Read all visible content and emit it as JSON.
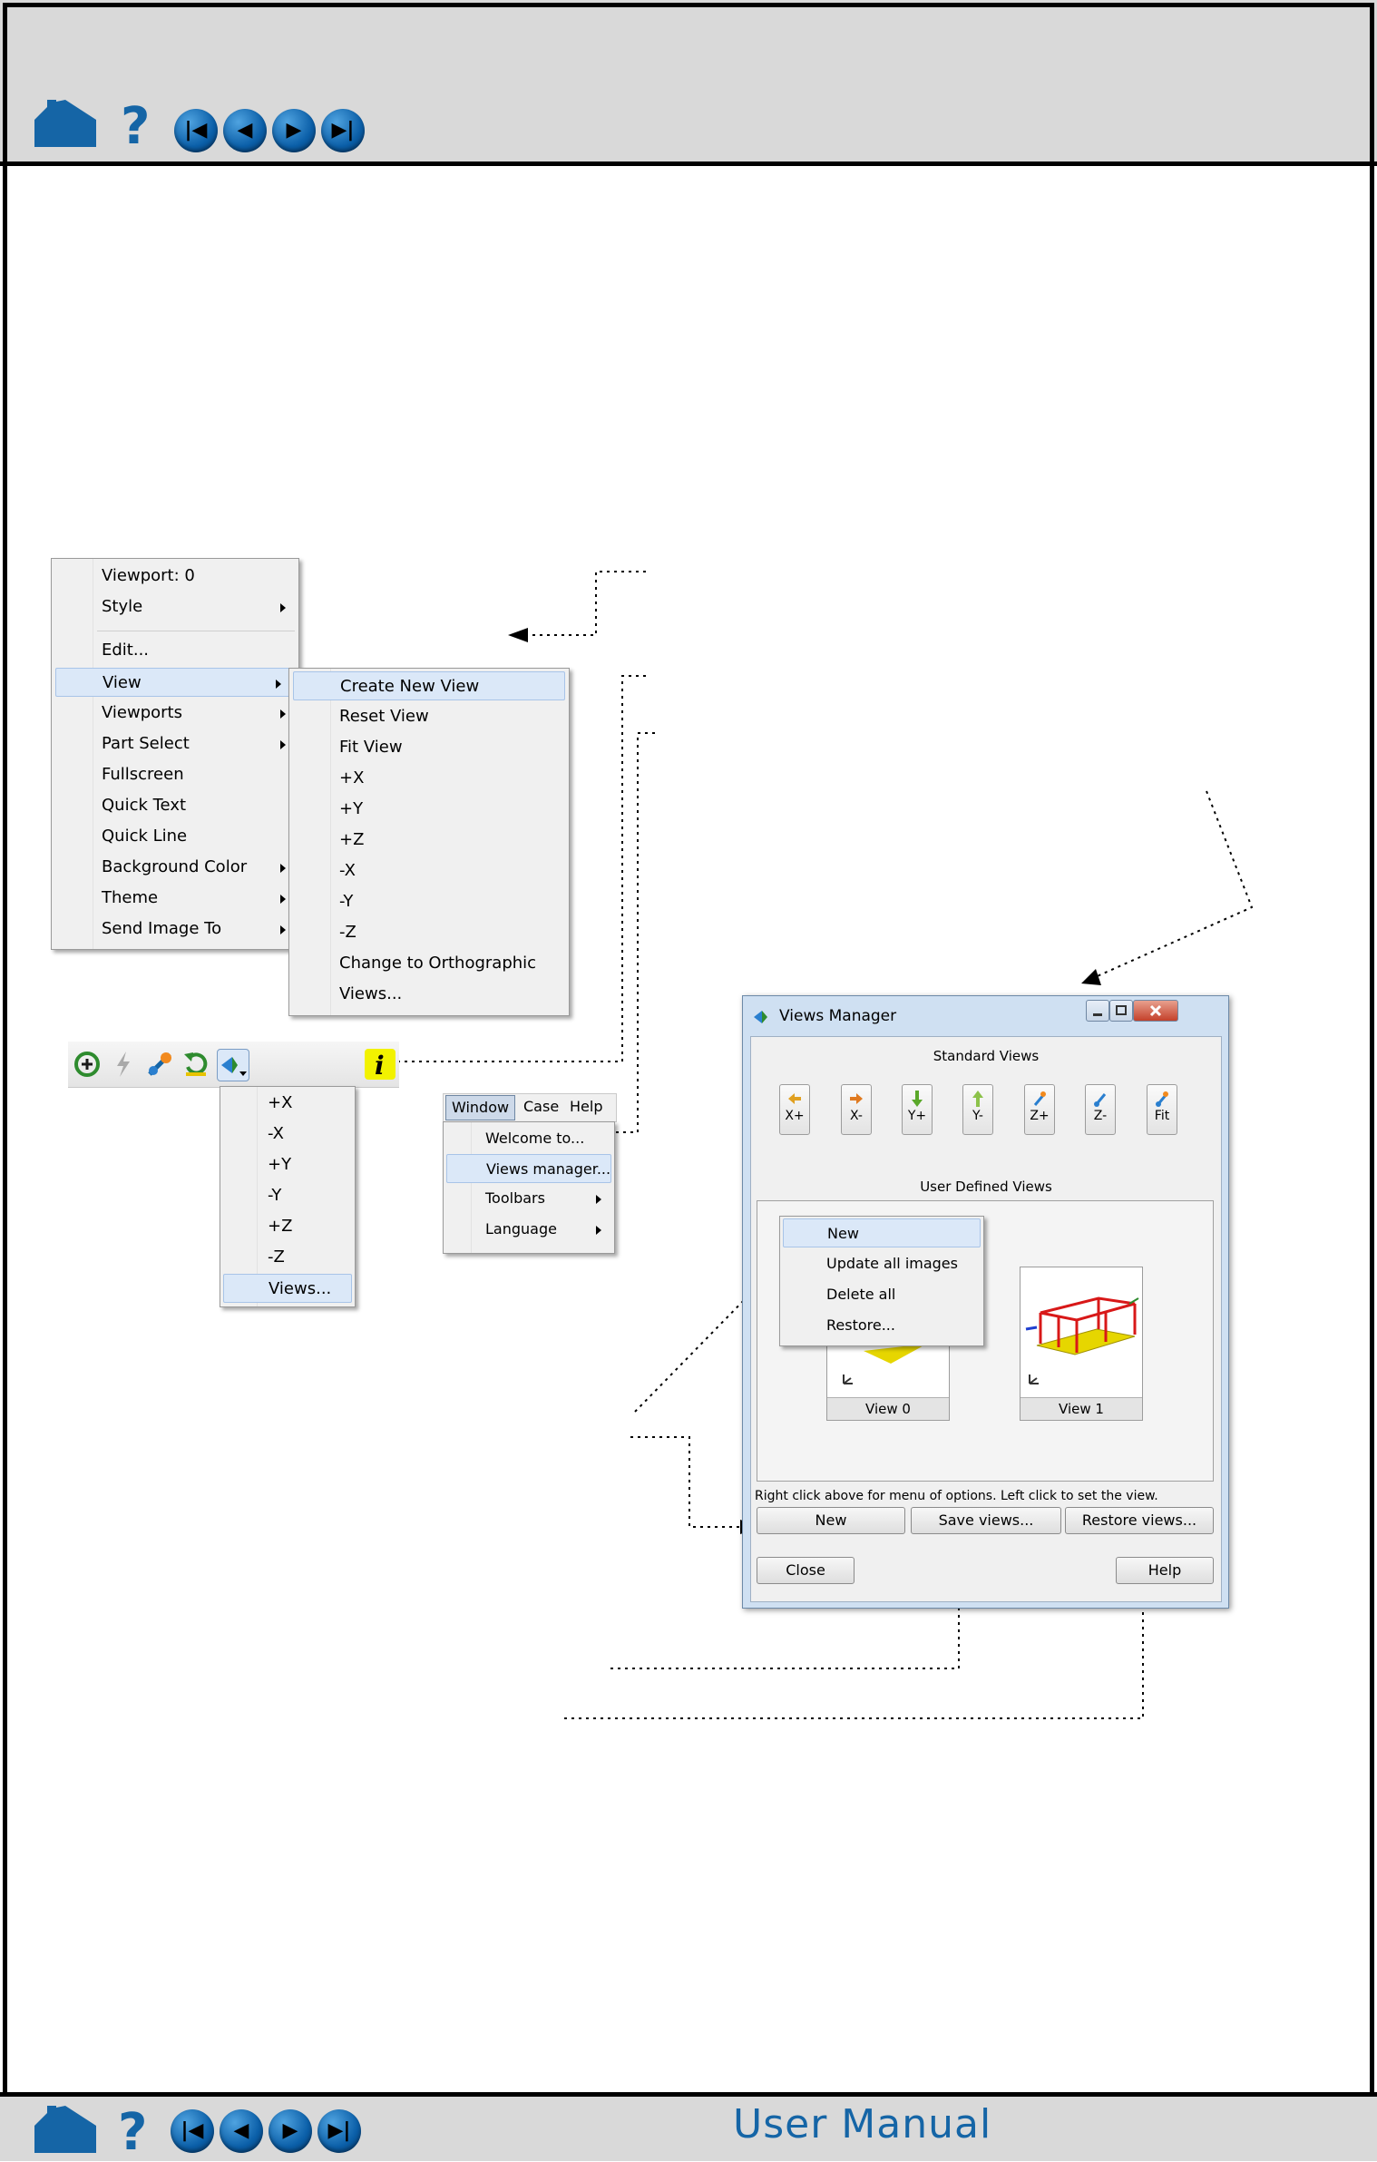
{
  "nav": {
    "help_glyph": "?",
    "first_glyph": "|◀",
    "prev_glyph": "◀",
    "next_glyph": "▶",
    "last_glyph": "▶|",
    "footer_title": "User Manual"
  },
  "context_menu": {
    "items": [
      {
        "label": "Viewport: 0"
      },
      {
        "label": "Style"
      },
      {
        "label": "Edit..."
      },
      {
        "label": "View"
      },
      {
        "label": "Viewports"
      },
      {
        "label": "Part Select"
      },
      {
        "label": "Fullscreen"
      },
      {
        "label": "Quick Text"
      },
      {
        "label": "Quick Line"
      },
      {
        "label": "Background Color"
      },
      {
        "label": "Theme"
      },
      {
        "label": "Send Image To"
      }
    ]
  },
  "view_submenu": {
    "items": [
      "Create New View",
      "Reset View",
      "Fit View",
      "+X",
      "+Y",
      "+Z",
      "-X",
      "-Y",
      "-Z",
      "Change to Orthographic",
      "Views..."
    ]
  },
  "toolbar_dropdown": {
    "items": [
      "+X",
      "-X",
      "+Y",
      "-Y",
      "+Z",
      "-Z",
      "Views..."
    ]
  },
  "menubar": {
    "items": [
      "Window",
      "Case",
      "Help"
    ],
    "window_menu": [
      "Welcome to...",
      "Views manager...",
      "Toolbars",
      "Language"
    ]
  },
  "views_manager": {
    "title": "Views Manager",
    "standard_views_label": "Standard Views",
    "standard_views": [
      "X+",
      "X-",
      "Y+",
      "Y-",
      "Z+",
      "Z-",
      "Fit"
    ],
    "user_defined_label": "User Defined Views",
    "popup_items": [
      "New",
      "Update all images",
      "Delete all",
      "Restore..."
    ],
    "thumbnails": [
      "View 0",
      "View 1"
    ],
    "hint": "Right click above for menu of options.  Left click to set the view.",
    "buttons": {
      "new": "New",
      "save": "Save views...",
      "restore": "Restore views...",
      "close": "Close",
      "help": "Help"
    }
  },
  "colors": {
    "header_band": "#d9d9d9",
    "accent_blue": "#1565a6",
    "menu_bg": "#f0f0f0",
    "selection": "#dbe8f8"
  }
}
